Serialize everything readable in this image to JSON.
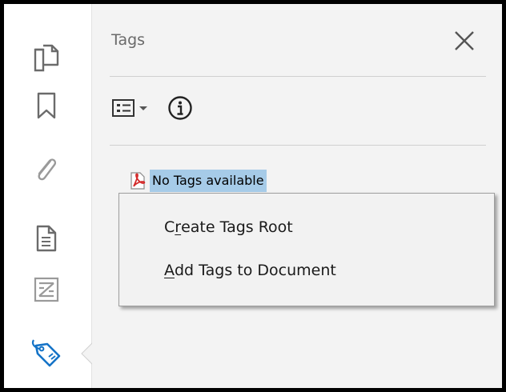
{
  "rail": {
    "items": [
      {
        "icon": "pages-icon"
      },
      {
        "icon": "bookmark-icon"
      },
      {
        "icon": "attachment-icon"
      },
      {
        "icon": "document-icon"
      },
      {
        "icon": "order-icon"
      },
      {
        "icon": "tag-icon",
        "active": true
      }
    ]
  },
  "panel": {
    "title": "Tags",
    "close_icon": "close-icon",
    "options_icon": "options-menu-icon",
    "info_icon": "info-icon",
    "tree": {
      "item_label": "No Tags available",
      "item_icon": "pdf-icon"
    }
  },
  "context_menu": {
    "items": [
      {
        "pre": "C",
        "mnemonic": "r",
        "post": "eate Tags Root"
      },
      {
        "pre": "",
        "mnemonic": "A",
        "post": "dd Tags to Document"
      }
    ]
  },
  "colors": {
    "selection": "#a6cbe8",
    "accent": "#0a73c6",
    "panel_bg": "#f3f3f3",
    "pdf_red": "#d42a2a"
  }
}
